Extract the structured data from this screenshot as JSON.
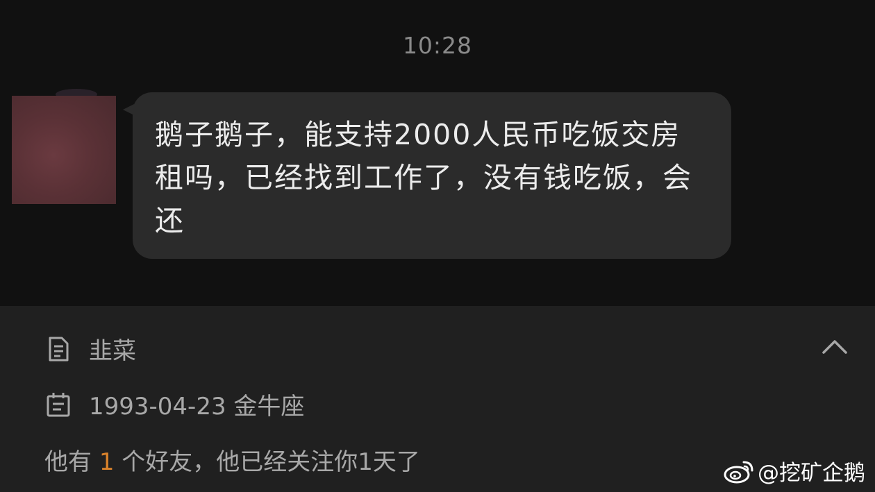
{
  "chat": {
    "timestamp": "10:28",
    "message": "鹅子鹅子，能支持2000人民币吃饭交房租吗，已经找到工作了，没有钱吃饭，会还"
  },
  "profile": {
    "name": "韭菜",
    "birthday": "1993-04-23 金牛座",
    "friends_prefix": "他有 ",
    "friends_count": "1",
    "friends_suffix": " 个好友，他已经关注你1天了"
  },
  "watermark": {
    "text": "@挖矿企鹅"
  },
  "icons": {
    "profile_name": "document-icon",
    "birthday": "calendar-icon",
    "collapse": "chevron-up-icon",
    "watermark": "weibo-icon"
  },
  "colors": {
    "accent": "#d9822b",
    "chat_background": "#111111",
    "bubble": "#2b2b2b",
    "panel": "#202020"
  }
}
